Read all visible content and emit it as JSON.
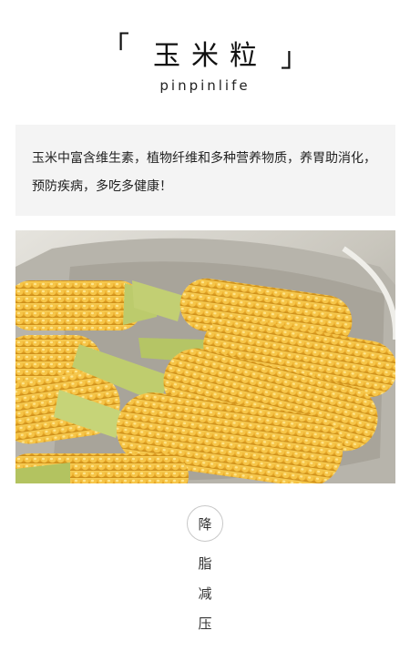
{
  "header": {
    "bracket_open": "「",
    "title": "玉米粒",
    "bracket_close": "」",
    "subtitle": "pinpinlife"
  },
  "description": {
    "text": "玉米中富含维生素，植物纤维和多种营养物质，养胃助消化，预防疾病，多吃多健康！"
  },
  "tags": [
    "降",
    "脂",
    "减",
    "压"
  ],
  "colors": {
    "desc_bg": "#f4f4f4",
    "corn_yellow": "#f2b83a",
    "husk_green": "#b9c96a",
    "pot_silver": "#cfcdc6"
  }
}
